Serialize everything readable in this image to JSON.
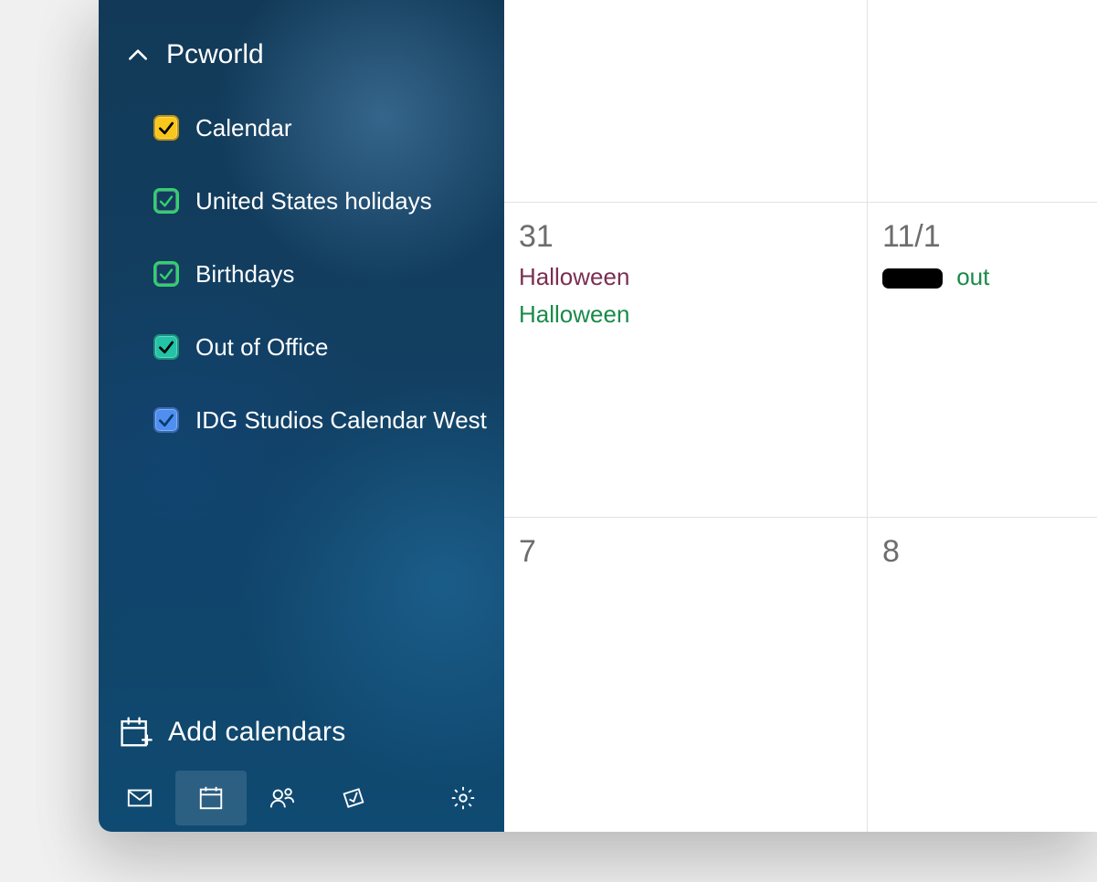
{
  "sidebar": {
    "account": {
      "name": "Pcworld"
    },
    "calendars": [
      {
        "key": "calendar",
        "label": "Calendar",
        "style": "filled",
        "fill": "#f8c61c",
        "check": "#000000"
      },
      {
        "key": "us-holidays",
        "label": "United States holidays",
        "style": "outline",
        "stroke": "#34cf6e",
        "check": "#34cf6e"
      },
      {
        "key": "birthdays",
        "label": "Birthdays",
        "style": "outline",
        "stroke": "#34cf6e",
        "check": "#34cf6e"
      },
      {
        "key": "out-of-office",
        "label": "Out of Office",
        "style": "filled",
        "fill": "#23c3a7",
        "check": "#000000"
      },
      {
        "key": "idg-studios",
        "label": "IDG Studios Calendar West",
        "style": "filled",
        "fill": "#4e8ff0",
        "check": "#043a6b"
      }
    ],
    "add_label": "Add calendars",
    "nav": [
      {
        "key": "mail",
        "icon": "mail-icon",
        "active": false
      },
      {
        "key": "calendar",
        "icon": "calendar-icon",
        "active": true
      },
      {
        "key": "people",
        "icon": "people-icon",
        "active": false
      },
      {
        "key": "todo",
        "icon": "todo-icon",
        "active": false
      },
      {
        "key": "settings",
        "icon": "gear-icon",
        "active": false
      }
    ]
  },
  "calendar_grid": {
    "rows": [
      {
        "left": {
          "date": "",
          "events": []
        },
        "right": {
          "date": "",
          "events": []
        }
      },
      {
        "left": {
          "date": "31",
          "events": [
            {
              "text": "Halloween",
              "color": "#7a2f52"
            },
            {
              "text": "Halloween",
              "color": "#1a8a4a"
            }
          ]
        },
        "right": {
          "date": "11/1",
          "events": [
            {
              "text": "out",
              "color": "#1a8a4a",
              "redacted": true
            }
          ]
        }
      },
      {
        "left": {
          "date": "7",
          "events": []
        },
        "right": {
          "date": "8",
          "events": []
        }
      }
    ]
  }
}
